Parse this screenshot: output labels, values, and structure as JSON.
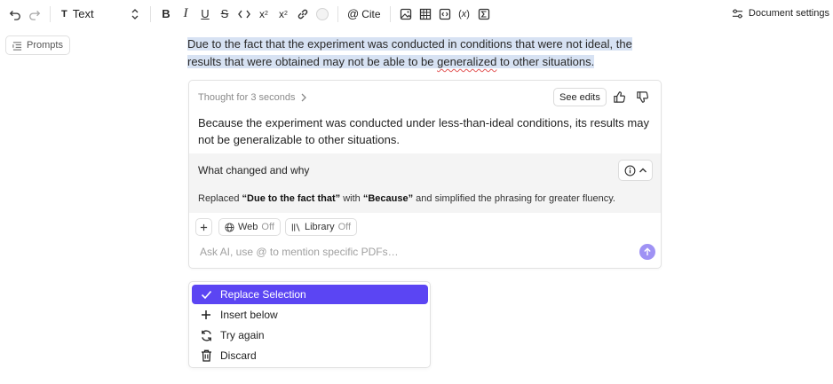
{
  "toolbar": {
    "text_style": "Text",
    "cite_label": "Cite",
    "document_settings": "Document settings"
  },
  "sidebar": {
    "prompts_label": "Prompts"
  },
  "document": {
    "selected_line1_a": "Due to the fact that the experiment was conducted in conditions that were not ideal, the",
    "selected_line2_a": "results that were obtained may not be able to be ",
    "selected_line2_b": "generalized",
    "selected_line2_c": " to other situations."
  },
  "ai_card": {
    "thought": "Thought for 3 seconds",
    "see_edits": "See edits",
    "suggestion": "Because the experiment was conducted under less-than-ideal conditions, its results may not be generalizable to other situations.",
    "changed_title": "What changed and why",
    "changed_pre": "Replaced ",
    "changed_from": "“Due to the fact that”",
    "changed_mid": " with ",
    "changed_to": "“Because”",
    "changed_post": " and simplified the phrasing for greater fluency.",
    "web_label": "Web",
    "web_state": "Off",
    "library_label": "Library",
    "library_state": "Off",
    "ask_placeholder": "Ask AI, use @ to mention specific PDFs…"
  },
  "menu": {
    "replace": "Replace Selection",
    "insert": "Insert below",
    "try_again": "Try again",
    "discard": "Discard"
  },
  "colors": {
    "accent": "#5b45f3",
    "send_button": "#9f92f4",
    "selection_highlight": "#d7e2f3"
  }
}
